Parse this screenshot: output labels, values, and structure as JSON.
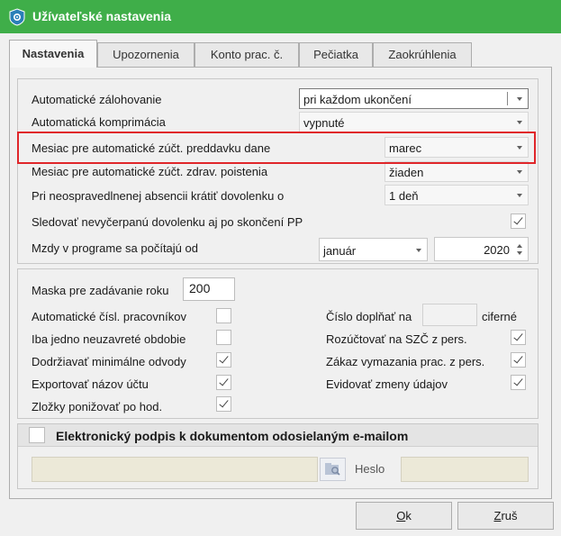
{
  "window": {
    "title": "Užívateľské nastavenia"
  },
  "tabs": [
    {
      "label": "Nastavenia"
    },
    {
      "label": "Upozornenia"
    },
    {
      "label": "Konto prac. č."
    },
    {
      "label": "Pečiatka"
    },
    {
      "label": "Zaokrúhlenia"
    }
  ],
  "settings": {
    "auto_backup": {
      "label": "Automatické zálohovanie",
      "value": "pri každom ukončení"
    },
    "auto_compress": {
      "label": "Automatická komprimácia",
      "value": "vypnuté"
    },
    "tax_month": {
      "label": "Mesiac pre automatické zúčt. preddavku dane",
      "value": "marec"
    },
    "health_month": {
      "label": "Mesiac pre automatické zúčt. zdrav. poistenia",
      "value": "žiaden"
    },
    "absence": {
      "label": "Pri neospravedlnenej absencii krátiť dovolenku o",
      "value": "1 deň"
    },
    "track_leave": {
      "label": "Sledovať nevyčerpanú dovolenku aj po skončení PP",
      "checked": true
    },
    "wages_from": {
      "label": "Mzdy v programe sa počítajú od",
      "month": "január",
      "year": "2020"
    }
  },
  "misc": {
    "year_mask": {
      "label": "Maska pre zadávanie roku",
      "value": "200"
    },
    "auto_numbering": {
      "label": "Automatické čísl. pracovníkov",
      "checked": false
    },
    "single_period": {
      "label": "Iba jedno neuzavreté obdobie",
      "checked": false
    },
    "min_deductions": {
      "label": "Dodržiavať minimálne odvody",
      "checked": true
    },
    "export_account": {
      "label": "Exportovať názov účtu",
      "checked": true
    },
    "lower_items": {
      "label": "Zložky ponižovať po hod.",
      "checked": true
    },
    "pad_number": {
      "label": "Číslo doplňať na",
      "value": "",
      "suffix": "ciferné"
    },
    "split_szc": {
      "label": "Rozúčtovať na SZČ z pers.",
      "checked": true
    },
    "no_delete": {
      "label": "Zákaz vymazania prac. z pers.",
      "checked": true
    },
    "track_changes": {
      "label": "Evidovať zmeny údajov",
      "checked": true
    }
  },
  "signature": {
    "label": "Elektronický podpis k dokumentom odosielaným e-mailom",
    "checked": false,
    "file_value": "",
    "password_label": "Heslo",
    "password_value": ""
  },
  "buttons": {
    "ok": {
      "hotkey": "O",
      "rest": "k"
    },
    "cancel": {
      "hotkey": "Z",
      "rest": "ruš"
    }
  },
  "colors": {
    "title_bar": "#3fae49",
    "highlight": "#e0262a"
  }
}
